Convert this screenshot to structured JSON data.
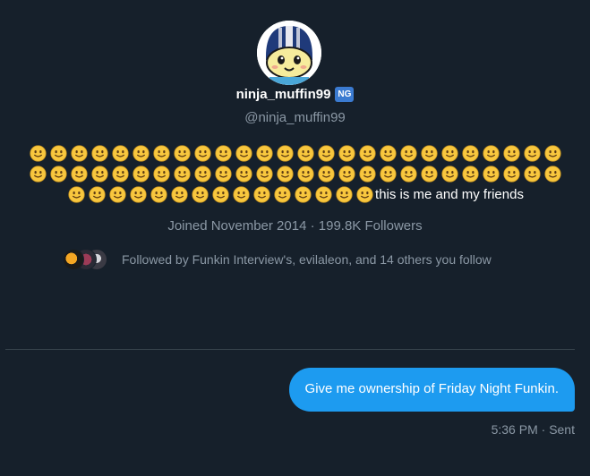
{
  "profile": {
    "display_name": "ninja_muffin99",
    "badge": "NG",
    "handle": "@ninja_muffin99",
    "avatar_icon": "ninja-mascot-icon",
    "bio": {
      "emoji_row1_count": 26,
      "emoji_row2_count": 26,
      "emoji_row3_count": 15,
      "emoji_icon": "slightly-smiling-face-icon",
      "text": "this is me and my friends"
    },
    "joined": "Joined November 2014 · 199.8K Followers",
    "followed_by": "Followed by Funkin Interview's, evilaleon, and 14 others you follow"
  },
  "conversation": {
    "message": "Give me ownership of Friday Night Funkin.",
    "time": "5:36 PM",
    "status_sep": " · ",
    "status": "Sent"
  },
  "colors": {
    "background": "#16202b",
    "bubble": "#1d9bf0",
    "muted_text": "#8b98a5",
    "badge": "#3b7bd1"
  }
}
